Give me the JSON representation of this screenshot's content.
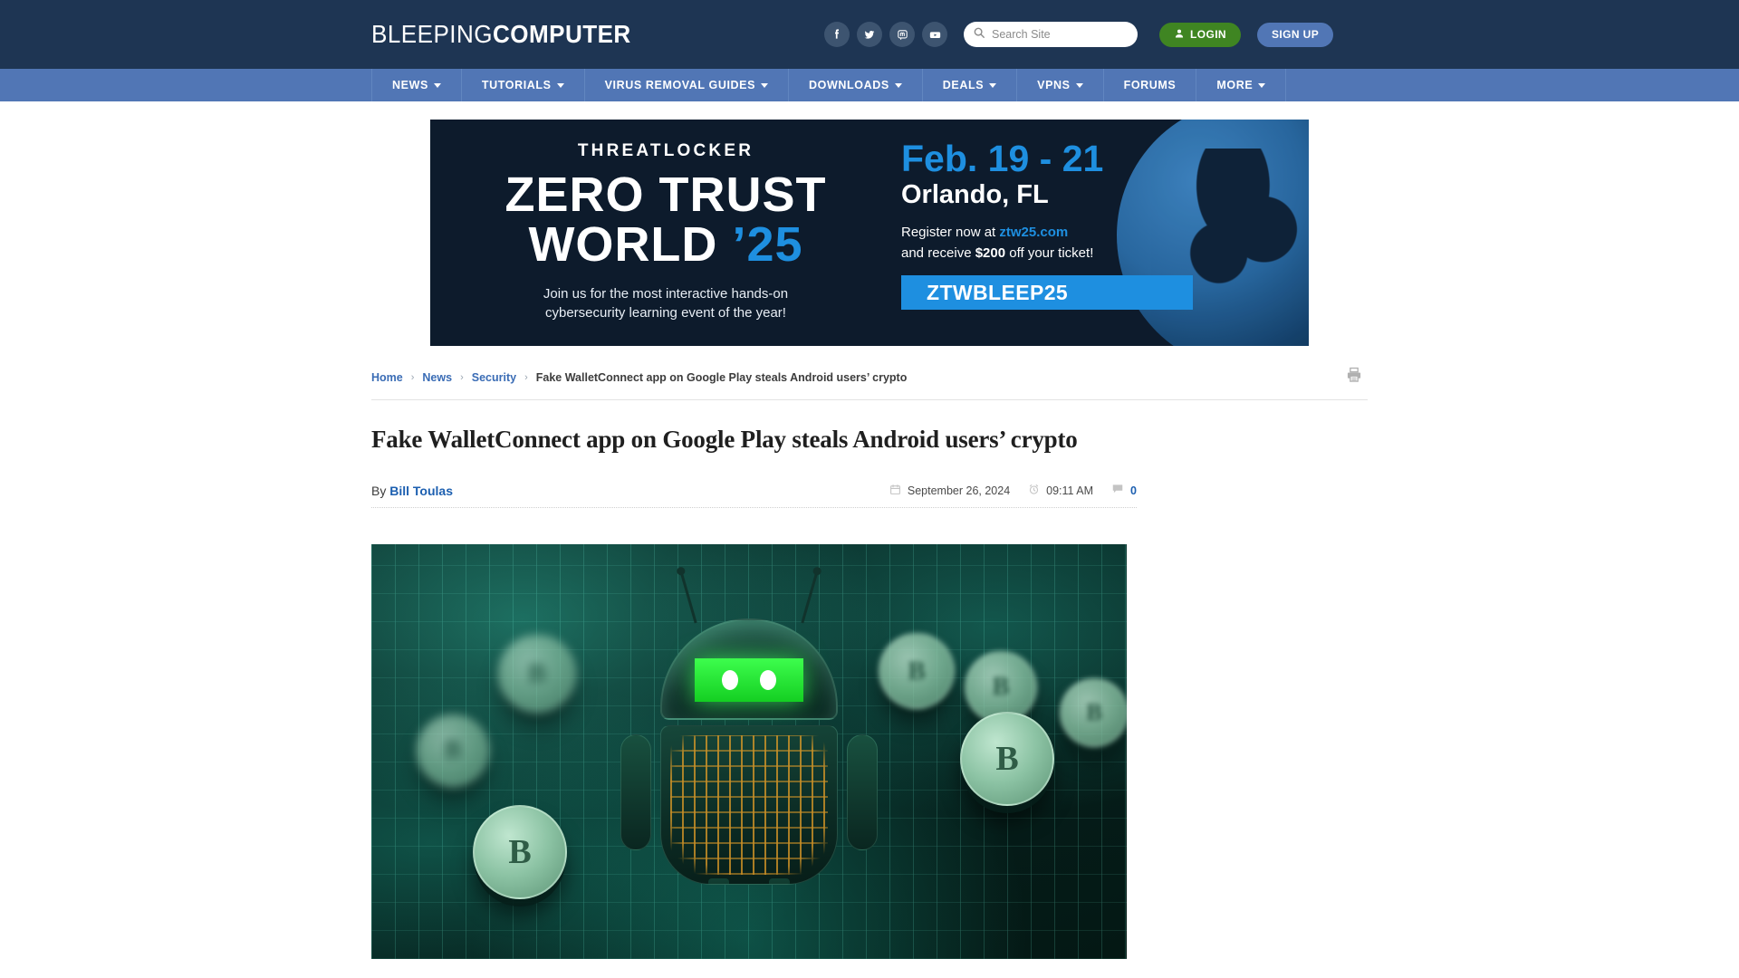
{
  "site": {
    "logo_light": "BLEEPING",
    "logo_bold": "COMPUTER"
  },
  "header": {
    "social": [
      {
        "name": "facebook-icon",
        "label": "Facebook"
      },
      {
        "name": "twitter-icon",
        "label": "Twitter"
      },
      {
        "name": "mastodon-icon",
        "label": "Mastodon"
      },
      {
        "name": "youtube-icon",
        "label": "YouTube"
      }
    ],
    "search": {
      "placeholder": "Search Site",
      "value": ""
    },
    "login_label": "LOGIN",
    "signup_label": "SIGN UP",
    "colors": {
      "header_bg": "#1e3553",
      "nav_bg": "#5176b5",
      "login_green": "#3f8522",
      "signup_blue": "#5176b5"
    }
  },
  "nav": {
    "items": [
      {
        "label": "NEWS",
        "has_dropdown": true
      },
      {
        "label": "TUTORIALS",
        "has_dropdown": true
      },
      {
        "label": "VIRUS REMOVAL GUIDES",
        "has_dropdown": true
      },
      {
        "label": "DOWNLOADS",
        "has_dropdown": true
      },
      {
        "label": "DEALS",
        "has_dropdown": true
      },
      {
        "label": "VPNS",
        "has_dropdown": true
      },
      {
        "label": "FORUMS",
        "has_dropdown": false
      },
      {
        "label": "MORE",
        "has_dropdown": true
      }
    ]
  },
  "ad": {
    "brand": "THREATLOCKER",
    "headline_line1": "ZERO TRUST",
    "headline_line2": "WORLD",
    "headline_year": "’25",
    "subtitle_line1": "Join us for the most interactive hands-on",
    "subtitle_line2": "cybersecurity learning event of the year!",
    "date": "Feb. 19 - 21",
    "city": "Orlando, FL",
    "register_prefix": "Register now at ",
    "register_link": "ztw25.com",
    "discount_prefix": "and receive ",
    "discount_amount": "$200",
    "discount_suffix": " off your ticket!",
    "promo_code": "ZTWBLEEP25",
    "accent_color": "#1e8fe0",
    "bg_color": "#0d1b2c"
  },
  "breadcrumb": {
    "items": [
      {
        "label": "Home",
        "is_link": true
      },
      {
        "label": "News",
        "is_link": true
      },
      {
        "label": "Security",
        "is_link": true
      },
      {
        "label": "Fake WalletConnect app on Google Play steals Android users’ crypto",
        "is_link": false
      }
    ],
    "separator": "›"
  },
  "article": {
    "title": "Fake WalletConnect app on Google Play steals Android users’ crypto",
    "by_prefix": "By ",
    "author": "Bill Toulas",
    "date": "September 26, 2024",
    "time": "09:11 AM",
    "comment_count": "0",
    "hero_alt": "Android robot on a circuit board surrounded by stacks of Bitcoin coins"
  },
  "toolbar": {
    "print_label": "Print"
  }
}
